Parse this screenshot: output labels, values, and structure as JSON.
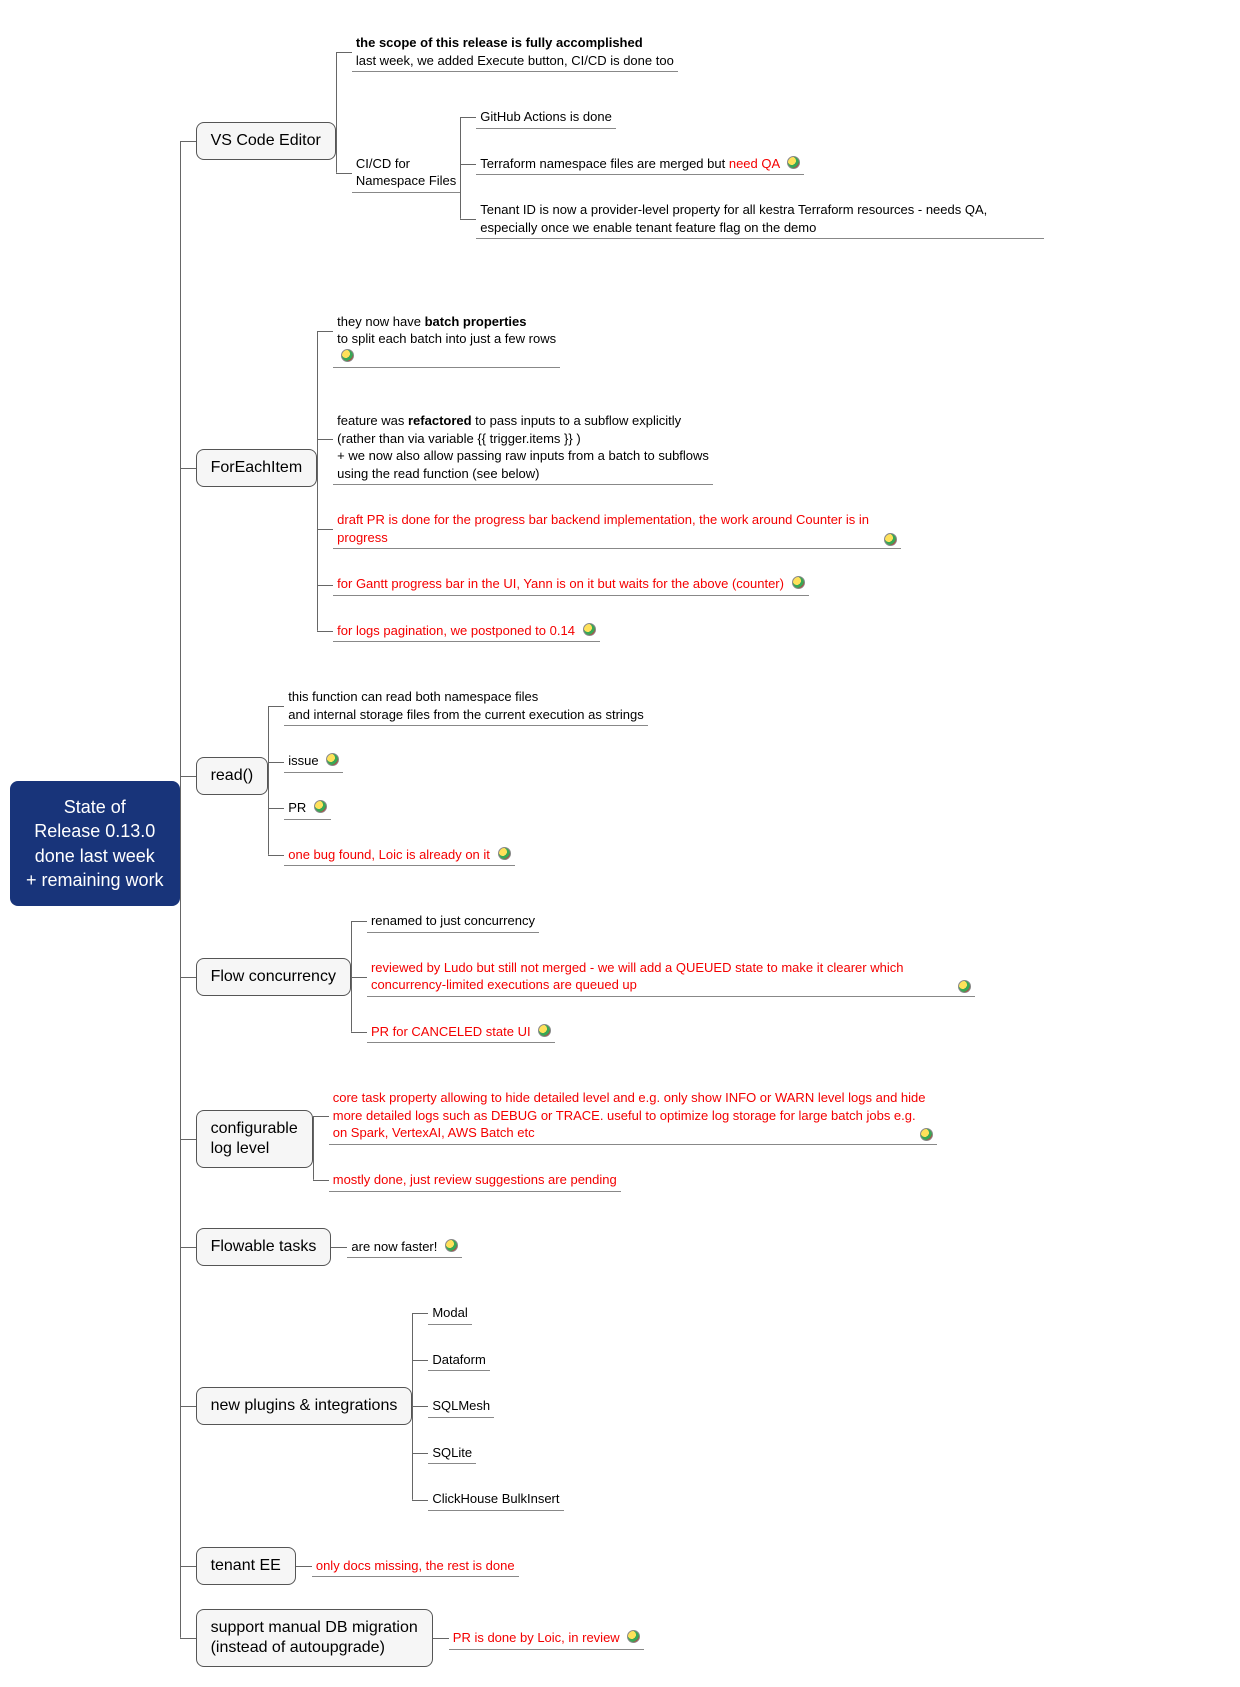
{
  "root": "State of\nRelease 0.13.0\ndone last week\n+ remaining work",
  "topics": {
    "vscode": "VS Code Editor",
    "foreach": "ForEachItem",
    "read": "read()",
    "flowconc": "Flow concurrency",
    "loglevel": "configurable\nlog level",
    "flowable": "Flowable tasks",
    "plugins": "new plugins & integrations",
    "tenant": "tenant EE",
    "dbmig": "support manual DB migration\n(instead of autoupgrade)"
  },
  "vscode": {
    "line1_bold": "the scope of this release is fully accomplished",
    "line1_rest": "last week, we added Execute button, CI/CD is done too",
    "cicd_label": "CI/CD for\nNamespace Files",
    "cicd_items": {
      "a": "GitHub Actions is done",
      "b_pre": "Terraform namespace files are merged but ",
      "b_red": "need QA",
      "c": "Tenant ID is now a provider-level property for all kestra Terraform resources - needs QA, especially once we enable tenant feature flag on the demo"
    }
  },
  "foreach": {
    "a_pre": "they now have ",
    "a_bold": "batch properties",
    "a_post": "\nto split each batch into just a few rows",
    "b_pre": "feature was ",
    "b_bold": "refactored",
    "b_post": " to pass inputs to a subflow explicitly\n(rather than via variable {{ trigger.items }} )\n+ we now also allow passing raw inputs from a batch to subflows\nusing the read function (see below)",
    "c": "draft PR is done for the progress bar backend implementation, the work around Counter is in progress",
    "d": "for Gantt progress bar in the UI, Yann is on it but waits for the above (counter)",
    "e": "for logs pagination, we postponed to 0.14"
  },
  "read": {
    "a": "this function can read both namespace files\nand internal storage files from the current execution  as strings",
    "b": "issue",
    "c": "PR",
    "d": "one bug found, Loic is already on it"
  },
  "flowconc": {
    "a": "renamed to just concurrency",
    "b": "reviewed by Ludo but still not merged - we will add a QUEUED state to make it clearer which concurrency-limited executions are queued up",
    "c": "PR for CANCELED state UI"
  },
  "loglevel": {
    "a": "core task property allowing to hide detailed level and e.g. only show INFO or WARN level logs and hide more detailed logs such as DEBUG or TRACE. useful to optimize log storage for large batch jobs e.g. on Spark, VertexAI, AWS Batch etc",
    "b": "mostly done, just review suggestions are pending"
  },
  "flowable": {
    "a": "are now faster!"
  },
  "plugins": {
    "a": "Modal",
    "b": "Dataform",
    "c": "SQLMesh",
    "d": "SQLite",
    "e": "ClickHouse BulkInsert"
  },
  "tenant": {
    "a": "only docs missing, the rest is done"
  },
  "dbmig": {
    "a": "PR is done by Loic, in review"
  }
}
